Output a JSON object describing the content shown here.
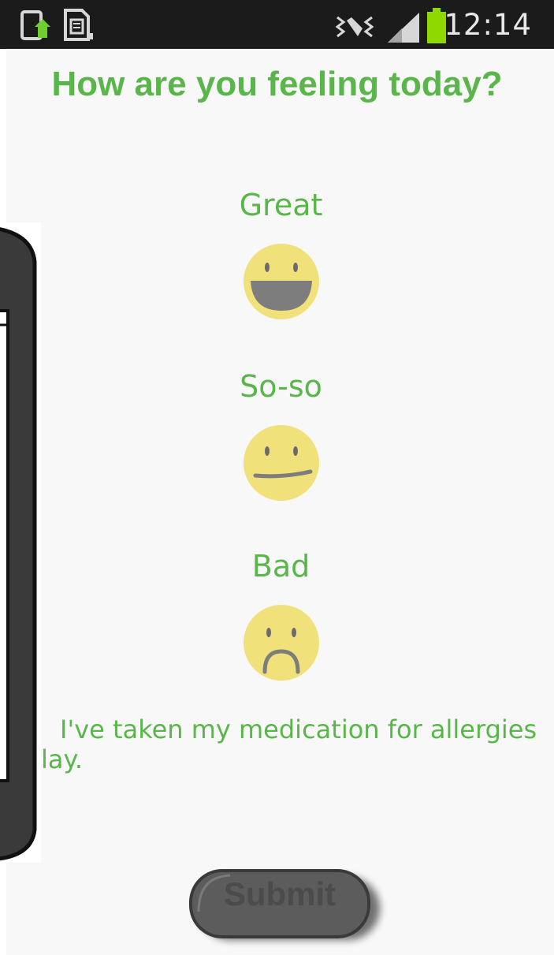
{
  "status_bar": {
    "time": "12:14",
    "icons": [
      "screen-rotate-icon",
      "sim-card-icon",
      "vibrate-icon",
      "signal-icon",
      "battery-icon"
    ],
    "battery_color": "#8fd800"
  },
  "page": {
    "title": "How are you feeling today?",
    "accent_color": "#5ab54b"
  },
  "moods": [
    {
      "label": "Great",
      "icon": "grinning-face-icon"
    },
    {
      "label": "So-so",
      "icon": "neutral-face-icon"
    },
    {
      "label": "Bad",
      "icon": "sad-face-icon"
    }
  ],
  "medication": {
    "line1": "I've taken my medication for allergies",
    "line2": "lay."
  },
  "submit": {
    "label": "Submit"
  }
}
